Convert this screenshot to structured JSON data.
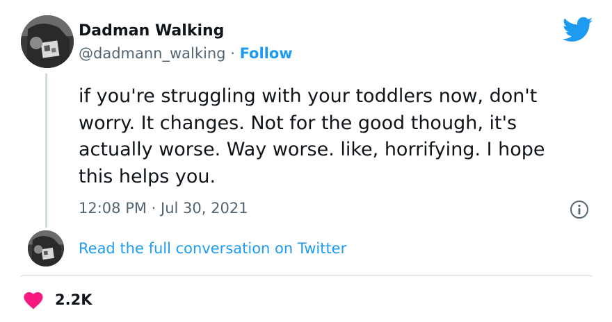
{
  "author": {
    "name": "Dadman Walking",
    "handle": "@dadmann_walking",
    "separator": "·",
    "follow_label": "Follow"
  },
  "tweet": {
    "text": "if you're struggling with your toddlers now, don't worry. It changes. Not for the good though, it's actually worse. Way worse. like, horrifying. I hope this helps you.",
    "time": "12:08 PM",
    "date_separator": "·",
    "date": "Jul 30, 2021"
  },
  "conversation": {
    "link_label": "Read the full conversation on Twitter"
  },
  "engagement": {
    "likes": "2.2K"
  },
  "icons": {
    "brand": "twitter-bird-icon",
    "info": "info-icon",
    "like": "heart-icon"
  },
  "colors": {
    "accent": "#1d9bf0",
    "heart": "#f91880",
    "secondary_text": "#536471",
    "primary_text": "#0f1419",
    "border": "#cfd9de"
  }
}
